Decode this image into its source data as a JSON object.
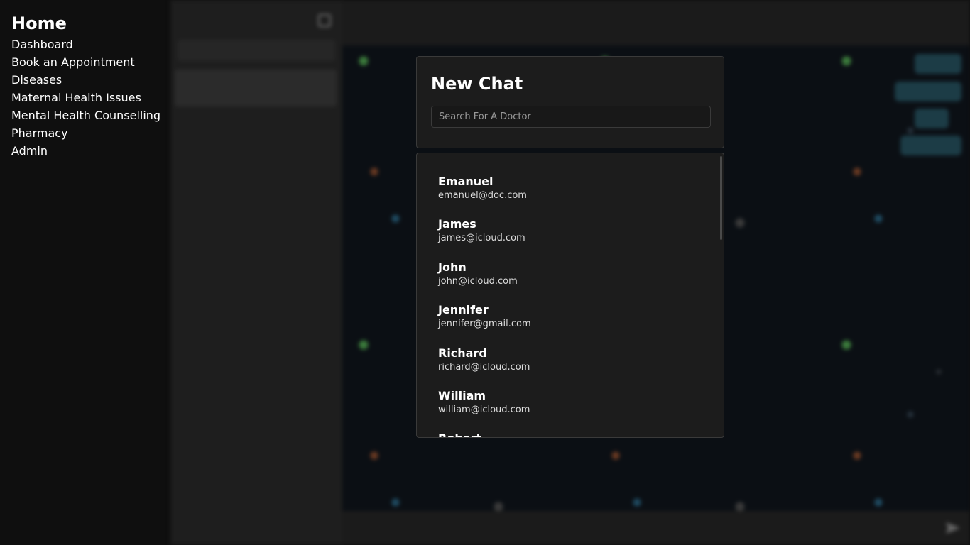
{
  "nav": {
    "home": "Home",
    "items": [
      {
        "label": "Dashboard"
      },
      {
        "label": "Book an Appointment"
      },
      {
        "label": "Diseases"
      },
      {
        "label": "Maternal Health Issues"
      },
      {
        "label": "Mental Health Counselling"
      },
      {
        "label": "Pharmacy"
      },
      {
        "label": "Admin"
      }
    ]
  },
  "modal": {
    "title": "New Chat",
    "search_placeholder": "Search For A Doctor",
    "doctors": [
      {
        "name": "Emanuel",
        "email": "emanuel@doc.com"
      },
      {
        "name": "James",
        "email": "james@icloud.com"
      },
      {
        "name": "John",
        "email": "john@icloud.com"
      },
      {
        "name": "Jennifer",
        "email": "jennifer@gmail.com"
      },
      {
        "name": "Richard",
        "email": "richard@icloud.com"
      },
      {
        "name": "William",
        "email": "william@icloud.com"
      },
      {
        "name": "Robert",
        "email": ""
      }
    ]
  },
  "colors": {
    "background": "#0e0e0e",
    "panel": "#1c1c1c",
    "panel_border": "#3a3a3a",
    "chat_bubble": "#1c3c46"
  }
}
